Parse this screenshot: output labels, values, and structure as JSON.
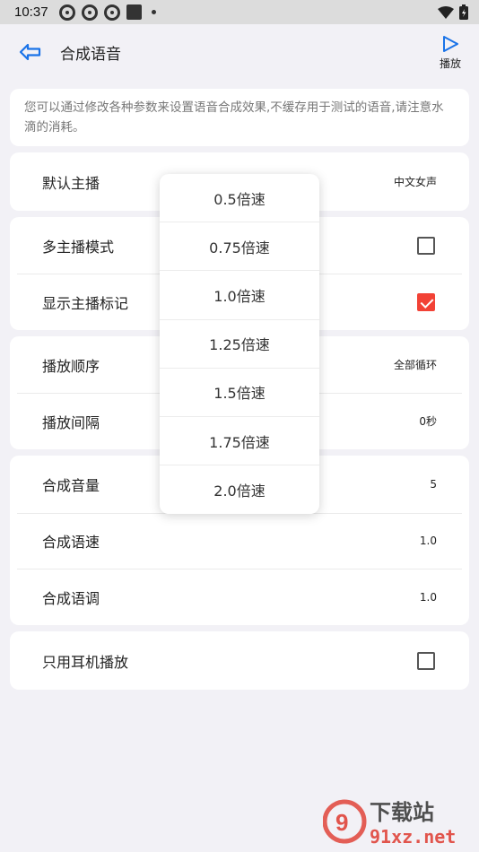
{
  "status_bar": {
    "time": "10:37"
  },
  "app_bar": {
    "title": "合成语音",
    "play_label": "播放"
  },
  "info_text": "您可以通过修改各种参数来设置语音合成效果,不缓存用于测试的语音,请注意水滴的消耗。",
  "settings": {
    "anchor": {
      "label": "默认主播",
      "value": "中文女声"
    },
    "multi_anchor": {
      "label": "多主播模式",
      "checked": false
    },
    "show_marker": {
      "label": "显示主播标记",
      "checked": true
    },
    "play_order": {
      "label": "播放顺序",
      "value": "全部循环"
    },
    "play_interval": {
      "label": "播放间隔",
      "value": "0秒"
    },
    "volume": {
      "label": "合成音量",
      "value": "5"
    },
    "speed": {
      "label": "合成语速",
      "value": "1.0"
    },
    "pitch": {
      "label": "合成语调",
      "value": "1.0"
    },
    "headphone_only": {
      "label": "只用耳机播放",
      "checked": false
    }
  },
  "speed_menu": [
    "0.5倍速",
    "0.75倍速",
    "1.0倍速",
    "1.25倍速",
    "1.5倍速",
    "1.75倍速",
    "2.0倍速"
  ],
  "watermark": {
    "brand": "下载站",
    "domain": "91xz.net"
  },
  "colors": {
    "accent": "#1a73e8",
    "checkbox_checked": "#f24236",
    "background": "#f2f1f6"
  }
}
